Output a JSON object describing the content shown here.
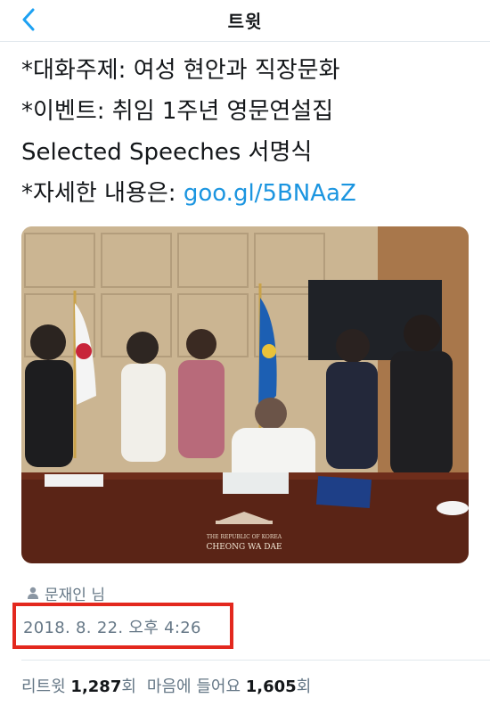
{
  "nav": {
    "title": "트윗",
    "back_icon": "chevron-left-icon"
  },
  "tweet": {
    "lines": [
      "*대화주제: 여성 현안과 직장문화",
      "*이벤트: 취임 1주년 영문연설집",
      "Selected Speeches 서명식",
      "*자세한 내용은: "
    ],
    "link": "goo.gl/5BNAaZ"
  },
  "photo": {
    "watermark_subtitle": "THE REPUBLIC OF KOREA",
    "watermark_title": "CHEONG WA DAE"
  },
  "author": {
    "icon": "person-icon",
    "label": "문재인 님"
  },
  "timestamp": "2018. 8. 22. 오후 4:26",
  "stats": {
    "retweets_label": "리트윗",
    "retweets_count": "1,287",
    "retweets_unit": "회",
    "likes_label": "마음에 들어요",
    "likes_count": "1,605",
    "likes_unit": "회"
  },
  "colors": {
    "link": "#1b95e0",
    "highlight_box": "#e3281e",
    "muted_text": "#657786"
  }
}
